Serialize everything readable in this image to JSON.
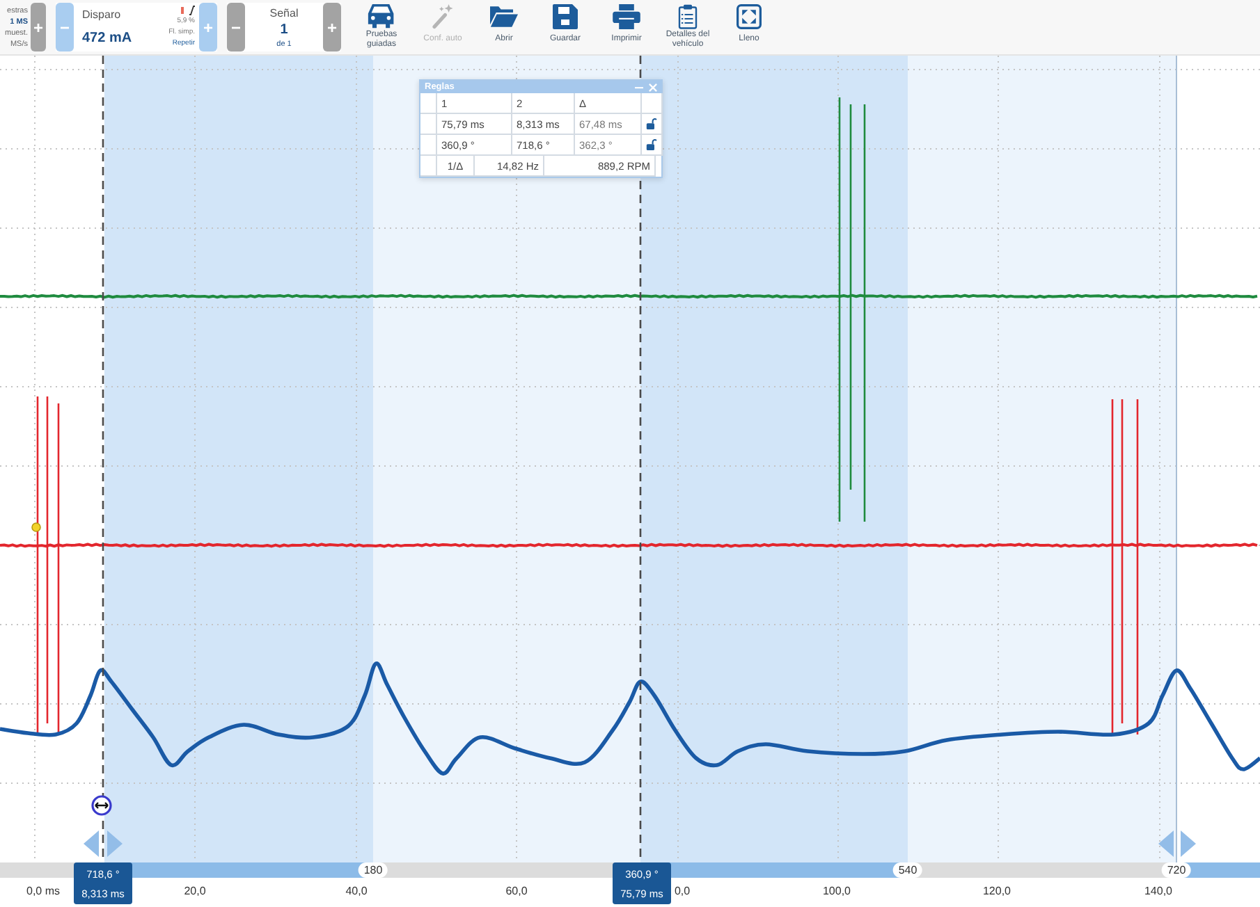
{
  "toolbar": {
    "samples": {
      "lines": [
        "estras",
        "1 MS",
        "muest.",
        "MS/s"
      ],
      "plus": {
        "label": "+",
        "disabled": true
      }
    },
    "trigger": {
      "minus": {
        "label": "−",
        "disabled": false
      },
      "label": "Disparo",
      "value": "472 mA",
      "details": [
        "5,9 %",
        "Fl. simp.",
        "Repetir"
      ],
      "plus": {
        "label": "+",
        "disabled": false
      }
    },
    "signal": {
      "minus": {
        "label": "−",
        "disabled": true
      },
      "label": "Señal",
      "value": "1",
      "of": "de 1",
      "plus": {
        "label": "+",
        "disabled": true
      }
    },
    "actions": [
      {
        "kind": "car",
        "label": "Pruebas guiadas",
        "disabled": false
      },
      {
        "kind": "wand",
        "label": "Conf. auto",
        "disabled": true
      },
      {
        "kind": "folder",
        "label": "Abrir",
        "disabled": false
      },
      {
        "kind": "save",
        "label": "Guardar",
        "disabled": false
      },
      {
        "kind": "print",
        "label": "Imprimir",
        "disabled": false
      },
      {
        "kind": "clipboard",
        "label": "Detalles del vehículo",
        "disabled": false
      },
      {
        "kind": "fullscreen",
        "label": "Lleno",
        "disabled": false
      }
    ]
  },
  "plot": {
    "traces": [
      {
        "color": "#1f8b3f"
      },
      {
        "color": "#e3262d"
      },
      {
        "color": "#1a5aa6"
      }
    ]
  },
  "rulers": {
    "title": "Reglas",
    "header": [
      "1",
      "2",
      "Δ"
    ],
    "rows": [
      {
        "cells": [
          "75,79 ms",
          "8,313 ms",
          "67,48 ms"
        ],
        "locked": false
      },
      {
        "cells": [
          "360,9 °",
          "718,6 °",
          "362,3 °"
        ],
        "locked": false
      }
    ],
    "footer": [
      "1/Δ",
      "14,82 Hz",
      "889,2 RPM"
    ]
  },
  "angle_scale": {
    "labels": [
      "180",
      "540",
      "720"
    ]
  },
  "cursors": [
    {
      "angle": "718,6 °",
      "time": "8,313 ms"
    },
    {
      "angle": "360,9 °",
      "time": "75,79 ms"
    }
  ],
  "time_axis": {
    "ticks": [
      "0,0 ms",
      "20,0",
      "40,0",
      "60,0",
      "0,0",
      "100,0",
      "120,0",
      "140,0"
    ]
  }
}
